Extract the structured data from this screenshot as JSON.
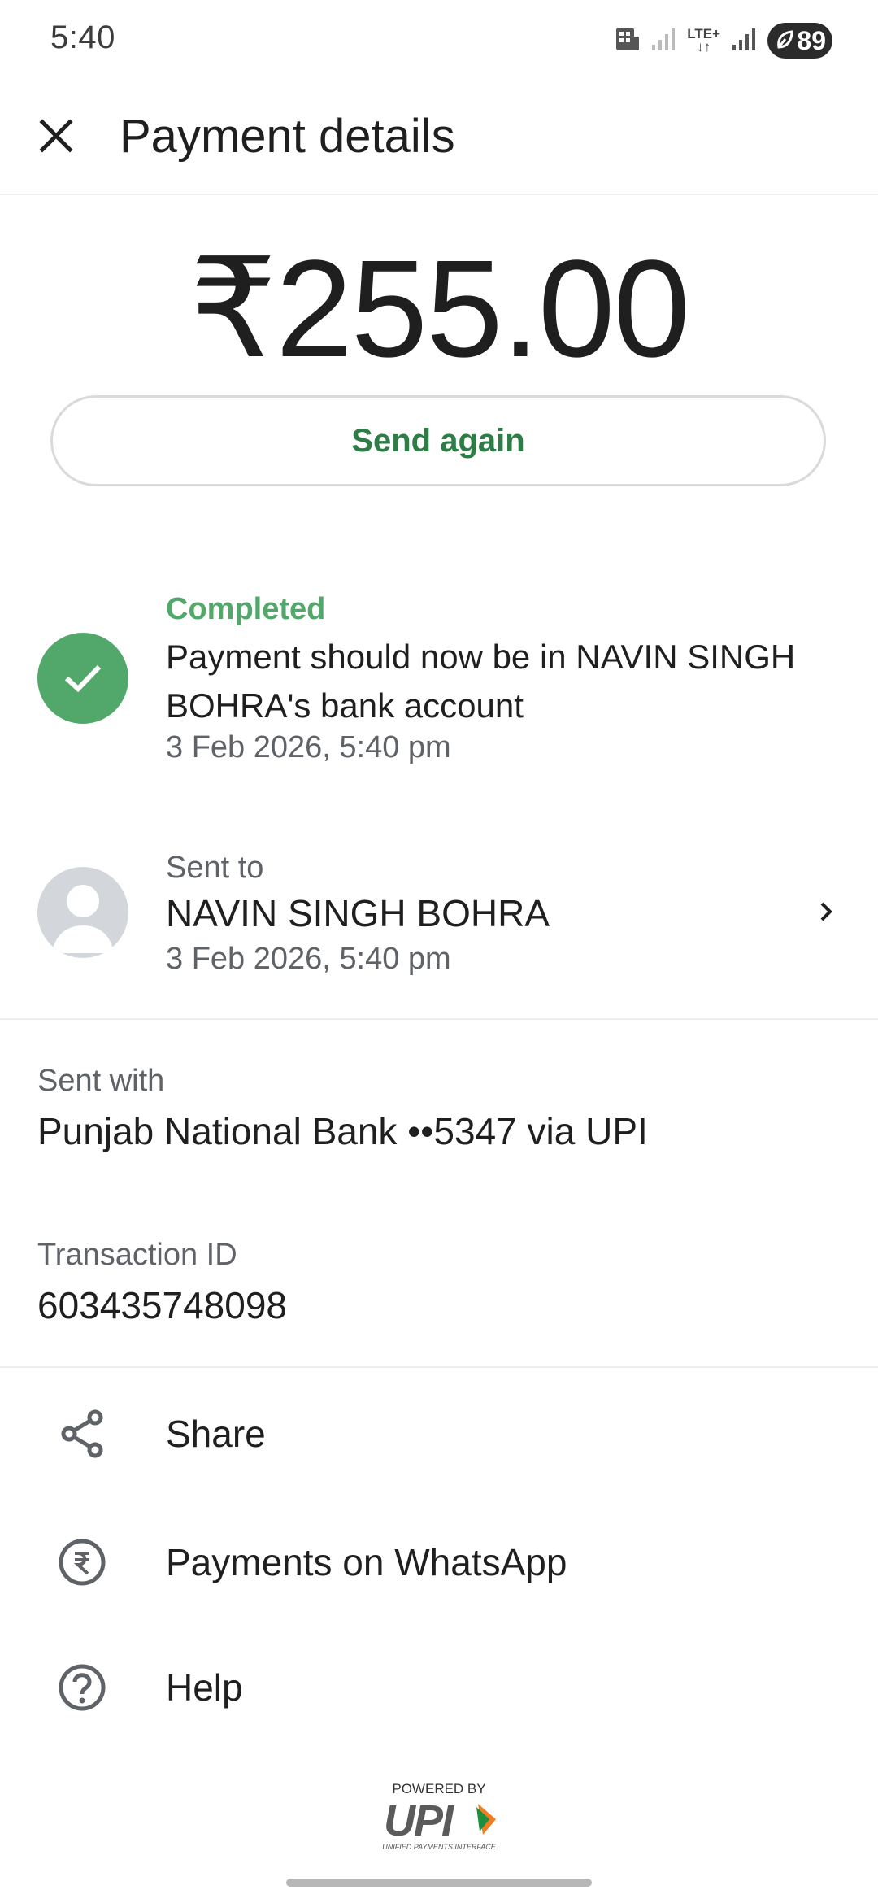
{
  "status_bar": {
    "time": "5:40",
    "network_label": "LTE+",
    "battery_level": "89"
  },
  "header": {
    "title": "Payment details"
  },
  "amount": "₹255.00",
  "send_again_label": "Send again",
  "payment_status": {
    "label": "Completed",
    "description": "Payment should now be in NAVIN SINGH BOHRA's bank account",
    "timestamp": "3 Feb 2026, 5:40 pm"
  },
  "recipient": {
    "label": "Sent to",
    "name": "NAVIN SINGH BOHRA",
    "timestamp": "3 Feb 2026, 5:40 pm"
  },
  "sent_with": {
    "label": "Sent with",
    "value": "Punjab National Bank ••5347 via UPI"
  },
  "transaction": {
    "label": "Transaction ID",
    "value": "603435748098"
  },
  "actions": [
    {
      "label": "Share",
      "icon": "share-icon"
    },
    {
      "label": "Payments on WhatsApp",
      "icon": "rupee-circle-icon"
    },
    {
      "label": "Help",
      "icon": "help-icon"
    }
  ],
  "footer": {
    "powered_by": "POWERED BY",
    "upi": "UPI",
    "upi_full": "UNIFIED PAYMENTS INTERFACE"
  },
  "colors": {
    "success": "#52a86a",
    "accent_text": "#2e7d47"
  }
}
